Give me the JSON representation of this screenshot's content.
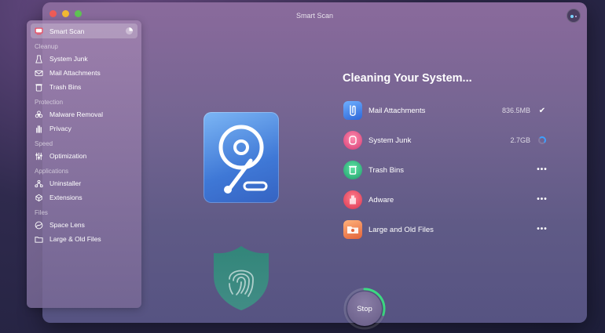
{
  "window": {
    "title": "Smart Scan"
  },
  "sidebar": {
    "top": {
      "label": "Smart Scan"
    },
    "sections": [
      {
        "title": "Cleanup",
        "items": [
          {
            "label": "System Junk",
            "icon": "broom-icon"
          },
          {
            "label": "Mail Attachments",
            "icon": "mail-icon"
          },
          {
            "label": "Trash Bins",
            "icon": "trash-icon"
          }
        ]
      },
      {
        "title": "Protection",
        "items": [
          {
            "label": "Malware Removal",
            "icon": "biohazard-icon"
          },
          {
            "label": "Privacy",
            "icon": "hand-icon"
          }
        ]
      },
      {
        "title": "Speed",
        "items": [
          {
            "label": "Optimization",
            "icon": "sliders-icon"
          }
        ]
      },
      {
        "title": "Applications",
        "items": [
          {
            "label": "Uninstaller",
            "icon": "uninstaller-icon"
          },
          {
            "label": "Extensions",
            "icon": "extensions-icon"
          }
        ]
      },
      {
        "title": "Files",
        "items": [
          {
            "label": "Space Lens",
            "icon": "space-lens-icon"
          },
          {
            "label": "Large & Old Files",
            "icon": "folder-icon"
          }
        ]
      }
    ]
  },
  "main": {
    "heading": "Cleaning Your System...",
    "tasks": [
      {
        "label": "Mail Attachments",
        "size": "836.5MB",
        "status": "done",
        "status_glyph": "✔"
      },
      {
        "label": "System Junk",
        "size": "2.7GB",
        "status": "in-progress",
        "status_glyph": ""
      },
      {
        "label": "Trash Bins",
        "size": "",
        "status": "pending",
        "status_glyph": "•••"
      },
      {
        "label": "Adware",
        "size": "",
        "status": "pending",
        "status_glyph": "•••"
      },
      {
        "label": "Large and Old Files",
        "size": "",
        "status": "pending",
        "status_glyph": "•••"
      }
    ],
    "stop_label": "Stop",
    "progress": 0.3
  },
  "colors": {
    "accent_progress": "#3ddc84",
    "spinner": "#3da0ff"
  }
}
